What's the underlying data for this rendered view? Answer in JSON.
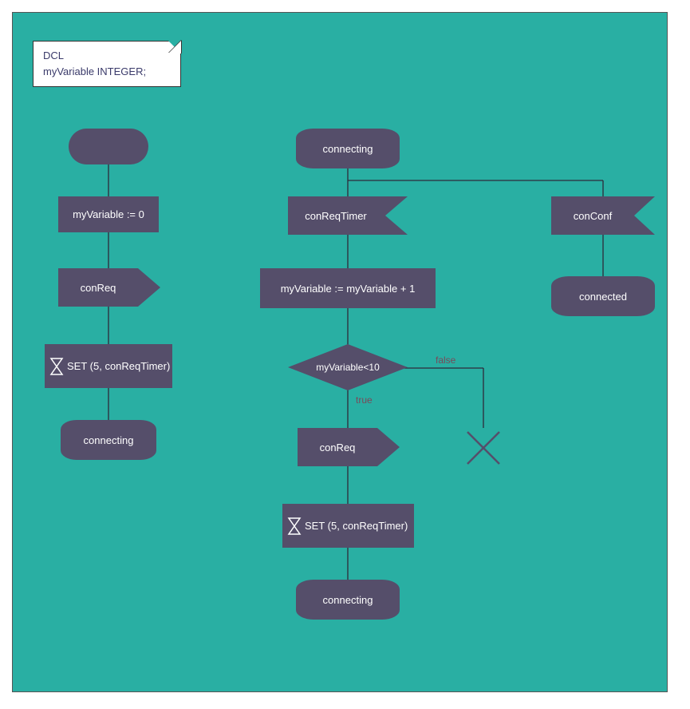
{
  "colors": {
    "panel_bg": "#29afa3",
    "shape_fill": "#554e6a",
    "text_light": "#ffffff",
    "text_note": "#3a3a6a",
    "label_color": "#7a4a5a"
  },
  "note": {
    "line1": "DCL",
    "line2": "myVariable INTEGER;"
  },
  "left_column": {
    "assign": "myVariable := 0",
    "output": "conReq",
    "timer": "SET (5, conReqTimer)",
    "state": "connecting"
  },
  "mid_column": {
    "state_top": "connecting",
    "input": "conReqTimer",
    "assign": "myVariable := myVariable + 1",
    "decision": "myVariable<10",
    "true_label": "true",
    "false_label": "false",
    "output": "conReq",
    "timer": "SET (5, conReqTimer)",
    "state_bottom": "connecting"
  },
  "right_column": {
    "input": "conConf",
    "state": "connected"
  },
  "chart_data": {
    "type": "sdl_flowchart",
    "declarations": [
      "DCL myVariable INTEGER;"
    ],
    "processes": [
      {
        "start": true,
        "steps": [
          {
            "type": "task",
            "text": "myVariable := 0"
          },
          {
            "type": "output",
            "text": "conReq"
          },
          {
            "type": "task_timer",
            "text": "SET (5, conReqTimer)"
          },
          {
            "type": "state",
            "text": "connecting"
          }
        ]
      },
      {
        "state": "connecting",
        "branches": [
          {
            "input": "conReqTimer",
            "steps": [
              {
                "type": "task",
                "text": "myVariable := myVariable + 1"
              },
              {
                "type": "decision",
                "text": "myVariable<10",
                "true": [
                  {
                    "type": "output",
                    "text": "conReq"
                  },
                  {
                    "type": "task_timer",
                    "text": "SET (5, conReqTimer)"
                  },
                  {
                    "type": "state",
                    "text": "connecting"
                  }
                ],
                "false": [
                  {
                    "type": "stop"
                  }
                ]
              }
            ]
          },
          {
            "input": "conConf",
            "steps": [
              {
                "type": "state",
                "text": "connected"
              }
            ]
          }
        ]
      }
    ]
  }
}
